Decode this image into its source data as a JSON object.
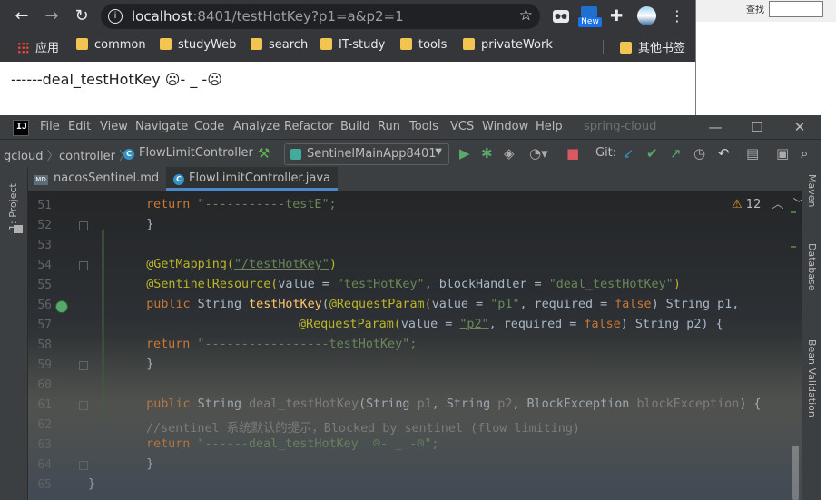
{
  "browser": {
    "url_host": "localhost",
    "url_rest": ":8401/testHotKey?p1=a&p2=1",
    "ext_new_badge": "New",
    "bookmarks": [
      "应用",
      "common",
      "studyWeb",
      "search",
      "IT-study",
      "tools",
      "privateWork",
      "其他书签"
    ],
    "page_text": "------deal_testHotKey ☹- _ -☹"
  },
  "background_window": {
    "label": "查找"
  },
  "ide": {
    "menus": [
      "File",
      "Edit",
      "View",
      "Navigate",
      "Code",
      "Analyze",
      "Refactor",
      "Build",
      "Run",
      "Tools",
      "VCS",
      "Window",
      "Help"
    ],
    "project_name": "spring-cloud",
    "breadcrumb": [
      "gcloud",
      "controller",
      "FlowLimitController"
    ],
    "run_config": "SentinelMainApp8401",
    "git_label": "Git:",
    "left_tool": "1: Project",
    "right_tools": [
      "Maven",
      "Database",
      "Bean Validation"
    ],
    "tabs": [
      "nacosSentinel.md",
      "FlowLimitController.java"
    ],
    "warnings_count": "12",
    "line_numbers": [
      "51",
      "52",
      "53",
      "54",
      "55",
      "56",
      "57",
      "58",
      "59",
      "60",
      "61",
      "62",
      "63",
      "64",
      "65"
    ],
    "code": {
      "l51_a": "return",
      "l51_b": " \"-----------testE\";",
      "l52": "}",
      "l54_a": "@GetMapping(",
      "l54_b": "\"/testHotKey\"",
      "l54_c": ")",
      "l55_a": "@SentinelResource(",
      "l55_b": "value = ",
      "l55_c": "\"testHotKey\"",
      "l55_d": ", blockHandler = ",
      "l55_e": "\"deal_testHotKey\"",
      "l55_f": ")",
      "l56_a": "public",
      "l56_b": " String ",
      "l56_c": "testHotKey",
      "l56_d": "(",
      "l56_e": "@RequestParam(",
      "l56_f": "value = ",
      "l56_g": "\"p1\"",
      "l56_h": ", required = ",
      "l56_i": "false",
      "l56_j": ") String p1,",
      "l57_a": "@RequestParam(",
      "l57_b": "value = ",
      "l57_c": "\"p2\"",
      "l57_d": ", required = ",
      "l57_e": "false",
      "l57_f": ") String p2) {",
      "l58_a": "return",
      "l58_b": " \"-----------------testHotKey\";",
      "l59": "}",
      "l61_a": "public",
      "l61_b": " String ",
      "l61_c": "deal_testHotKey",
      "l61_d": "(String ",
      "l61_e": "p1",
      "l61_f": ", String ",
      "l61_g": "p2",
      "l61_h": ", BlockException ",
      "l61_i": "blockException",
      "l61_j": ") {",
      "l62": "//sentinel 系统默认的提示，Blocked by sentinel (flow limiting)",
      "l63_a": "return",
      "l63_b": " \"------deal_testHotKey  ☹- _ -☹\";",
      "l64": "}",
      "l65": "}"
    }
  }
}
